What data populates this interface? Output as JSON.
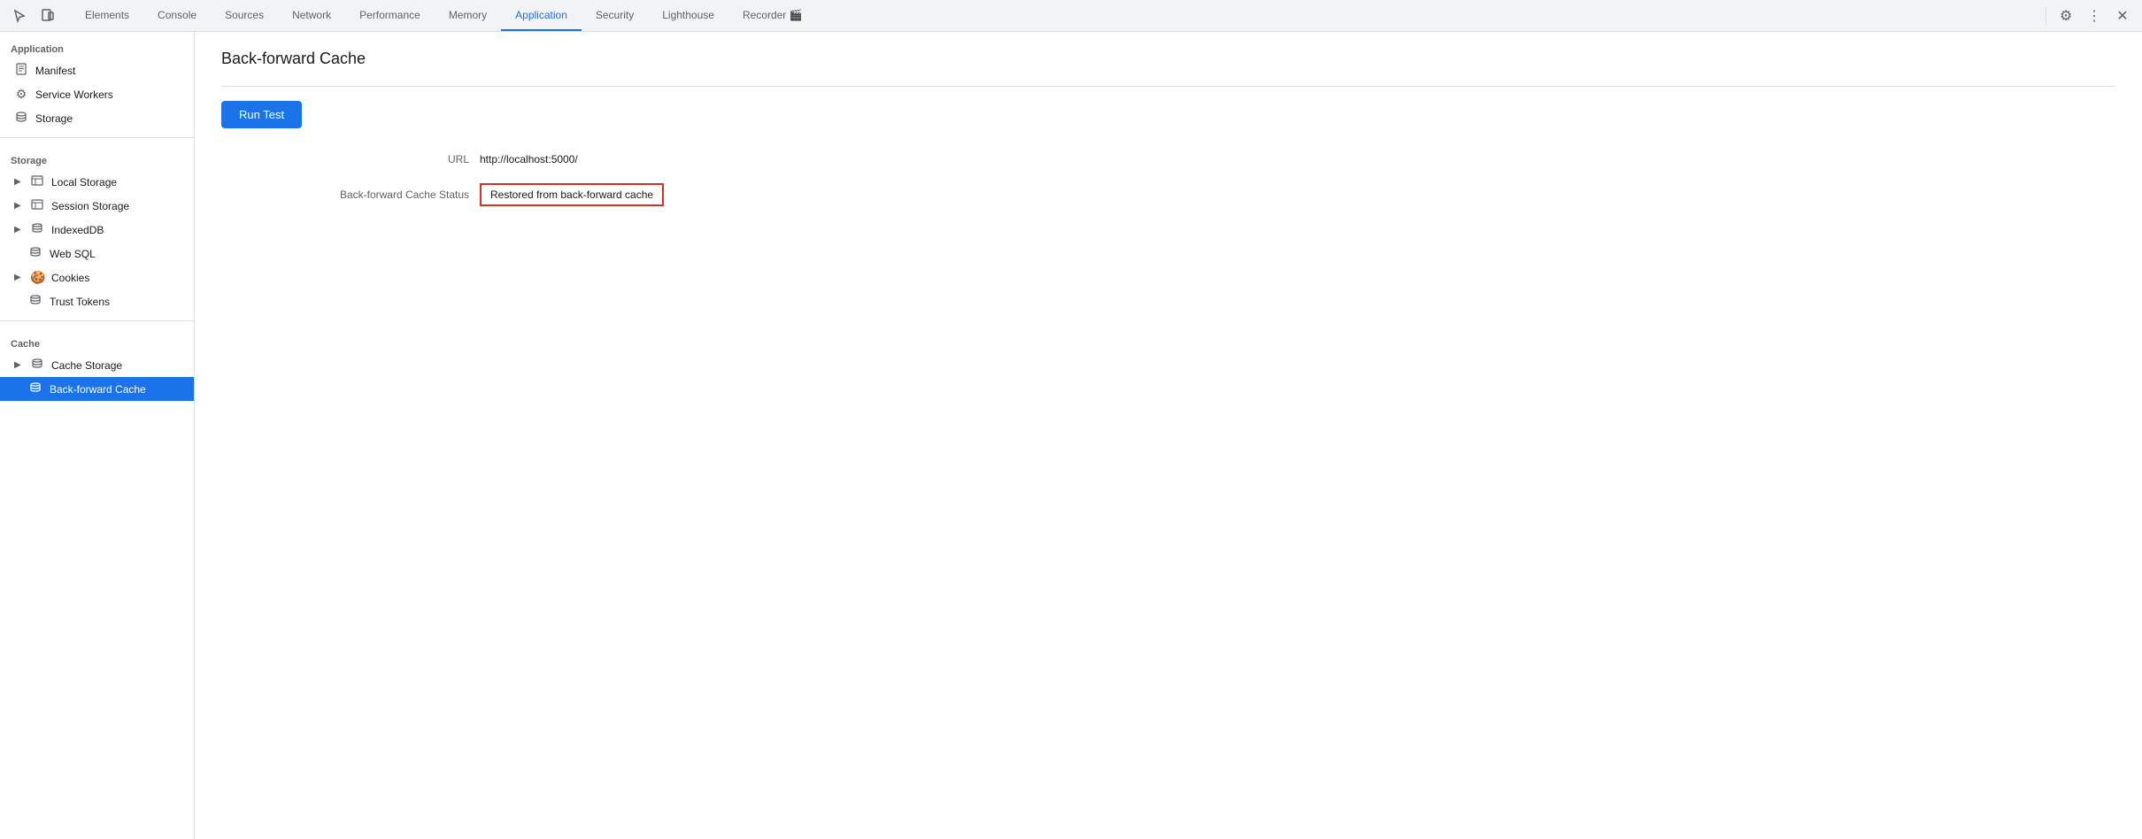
{
  "tabbar": {
    "tabs": [
      {
        "id": "elements",
        "label": "Elements",
        "active": false
      },
      {
        "id": "console",
        "label": "Console",
        "active": false
      },
      {
        "id": "sources",
        "label": "Sources",
        "active": false
      },
      {
        "id": "network",
        "label": "Network",
        "active": false
      },
      {
        "id": "performance",
        "label": "Performance",
        "active": false
      },
      {
        "id": "memory",
        "label": "Memory",
        "active": false
      },
      {
        "id": "application",
        "label": "Application",
        "active": true
      },
      {
        "id": "security",
        "label": "Security",
        "active": false
      },
      {
        "id": "lighthouse",
        "label": "Lighthouse",
        "active": false
      },
      {
        "id": "recorder",
        "label": "Recorder 🎬",
        "active": false
      }
    ]
  },
  "sidebar": {
    "sections": [
      {
        "id": "application",
        "header": "Application",
        "items": [
          {
            "id": "manifest",
            "icon": "📄",
            "label": "Manifest",
            "hasChevron": false
          },
          {
            "id": "service-workers",
            "icon": "⚙️",
            "label": "Service Workers",
            "hasChevron": false
          },
          {
            "id": "storage",
            "icon": "🗄️",
            "label": "Storage",
            "hasChevron": false
          }
        ]
      },
      {
        "id": "storage",
        "header": "Storage",
        "items": [
          {
            "id": "local-storage",
            "icon": "▦",
            "label": "Local Storage",
            "hasChevron": true
          },
          {
            "id": "session-storage",
            "icon": "▦",
            "label": "Session Storage",
            "hasChevron": true
          },
          {
            "id": "indexeddb",
            "icon": "🗄️",
            "label": "IndexedDB",
            "hasChevron": true
          },
          {
            "id": "web-sql",
            "icon": "🗄️",
            "label": "Web SQL",
            "hasChevron": false
          },
          {
            "id": "cookies",
            "icon": "🍪",
            "label": "Cookies",
            "hasChevron": true
          },
          {
            "id": "trust-tokens",
            "icon": "🗄️",
            "label": "Trust Tokens",
            "hasChevron": false
          }
        ]
      },
      {
        "id": "cache",
        "header": "Cache",
        "items": [
          {
            "id": "cache-storage",
            "icon": "🗄️",
            "label": "Cache Storage",
            "hasChevron": true
          },
          {
            "id": "back-forward-cache",
            "icon": "🗄️",
            "label": "Back-forward Cache",
            "hasChevron": false,
            "active": true
          }
        ]
      }
    ]
  },
  "content": {
    "title": "Back-forward Cache",
    "run_test_label": "Run Test",
    "url_label": "URL",
    "url_value": "http://localhost:5000/",
    "cache_status_label": "Back-forward Cache Status",
    "cache_status_value": "Restored from back-forward cache"
  }
}
